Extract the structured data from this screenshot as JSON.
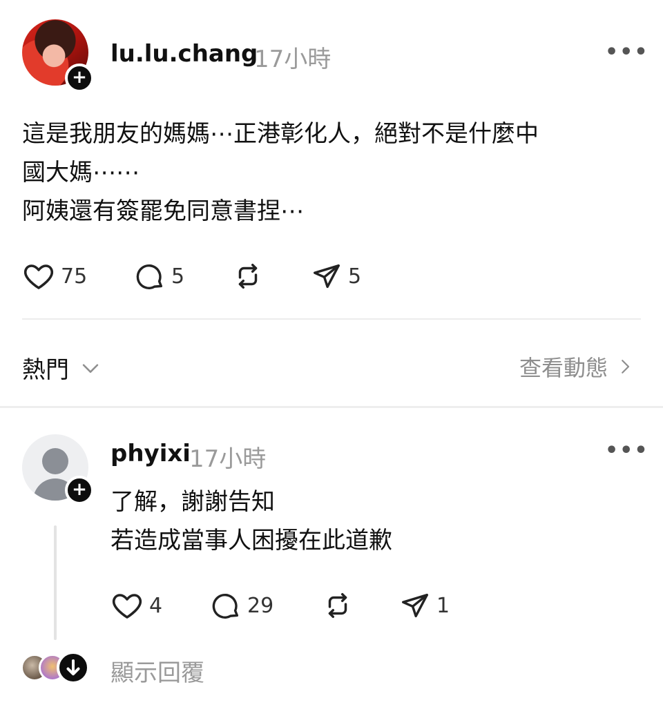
{
  "post": {
    "username": "lu.lu.chang",
    "timestamp": "17小時",
    "follow_symbol": "+",
    "more_symbol": "•••",
    "lines": [
      "這是我朋友的媽媽⋯正港彰化人，絕對不是什麼中",
      "國大媽⋯⋯",
      "阿姨還有簽罷免同意書捏⋯"
    ],
    "actions": {
      "likes": "75",
      "comments": "5",
      "reposts": "",
      "shares": "5"
    }
  },
  "sort": {
    "label": "熱門",
    "view_activity": "查看動態"
  },
  "reply": {
    "username": "phyixi",
    "timestamp": "17小時",
    "follow_symbol": "+",
    "more_symbol": "•••",
    "lines": [
      "了解，謝謝告知",
      "若造成當事人困擾在此道歉"
    ],
    "actions": {
      "likes": "4",
      "comments": "29",
      "reposts": "",
      "shares": "1"
    },
    "show_replies": "顯示回覆"
  },
  "icons": {
    "like": "heart-icon",
    "comment": "speech-bubble-icon",
    "repost": "repost-icon",
    "share": "send-icon",
    "more": "more-dots-icon",
    "sort": "chevron-down-icon",
    "view": "chevron-right-icon",
    "expand": "arrow-down-icon"
  }
}
